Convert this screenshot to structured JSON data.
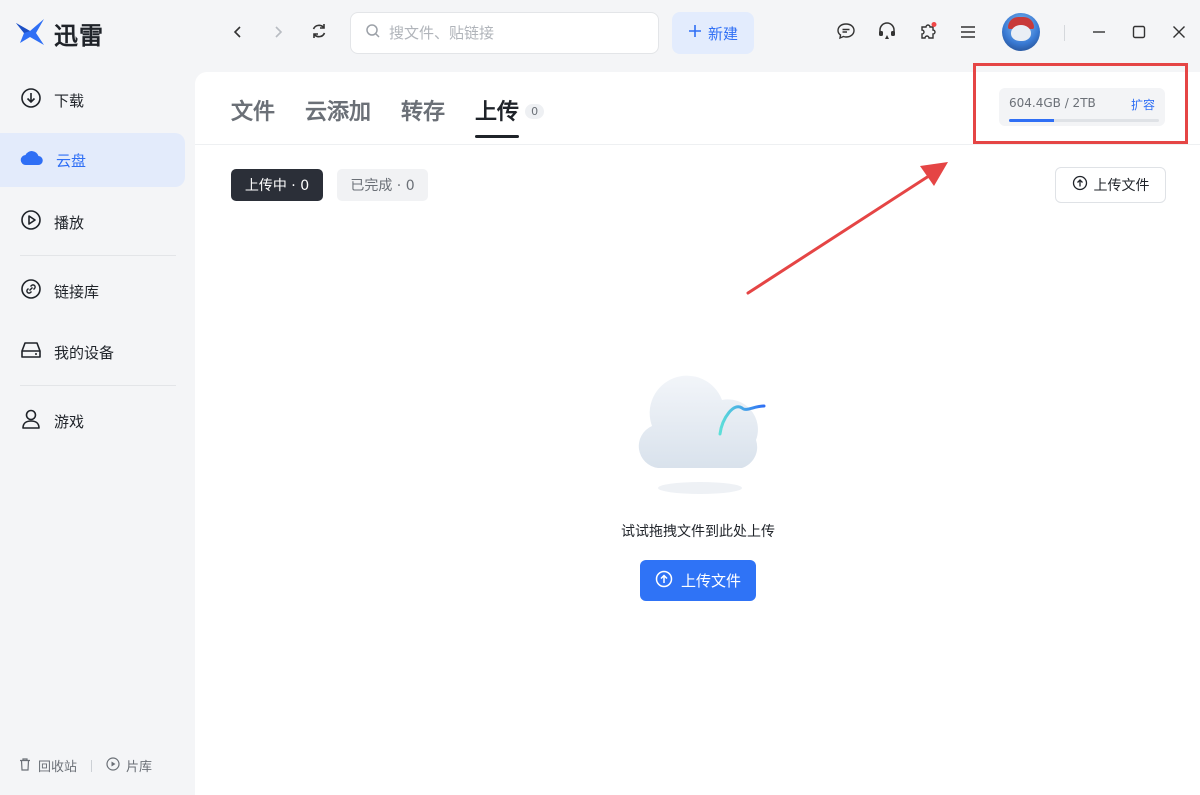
{
  "app": {
    "name": "迅雷"
  },
  "toolbar": {
    "search_placeholder": "搜文件、贴链接",
    "new_label": "新建",
    "icons": [
      "back-icon",
      "forward-icon",
      "refresh-icon",
      "message-icon",
      "headset-icon",
      "plugin-icon",
      "menu-icon"
    ]
  },
  "sidebar": {
    "items": [
      {
        "label": "下载",
        "icon": "download-icon"
      },
      {
        "label": "云盘",
        "icon": "cloud-icon",
        "active": true
      },
      {
        "label": "播放",
        "icon": "play-icon"
      },
      {
        "label": "链接库",
        "icon": "link-icon"
      },
      {
        "label": "我的设备",
        "icon": "device-icon"
      },
      {
        "label": "游戏",
        "icon": "game-icon"
      }
    ],
    "footer": {
      "recycle_label": "回收站",
      "library_label": "片库"
    }
  },
  "main": {
    "tabs": [
      {
        "label": "文件"
      },
      {
        "label": "云添加"
      },
      {
        "label": "转存"
      },
      {
        "label": "上传",
        "badge": "0",
        "active": true
      }
    ],
    "storage": {
      "usage_text": "604.4GB / 2TB",
      "expand_label": "扩容",
      "used_fraction": 0.3
    },
    "filters": {
      "uploading_label": "上传中 · 0",
      "done_label": "已完成 · 0"
    },
    "upload_outline_label": "上传文件",
    "empty": {
      "hint": "试试拖拽文件到此处上传",
      "upload_button_label": "上传文件"
    }
  },
  "colors": {
    "accent": "#2f6ff5",
    "highlight": "#e54545",
    "active_bg": "#e3ebfb"
  }
}
